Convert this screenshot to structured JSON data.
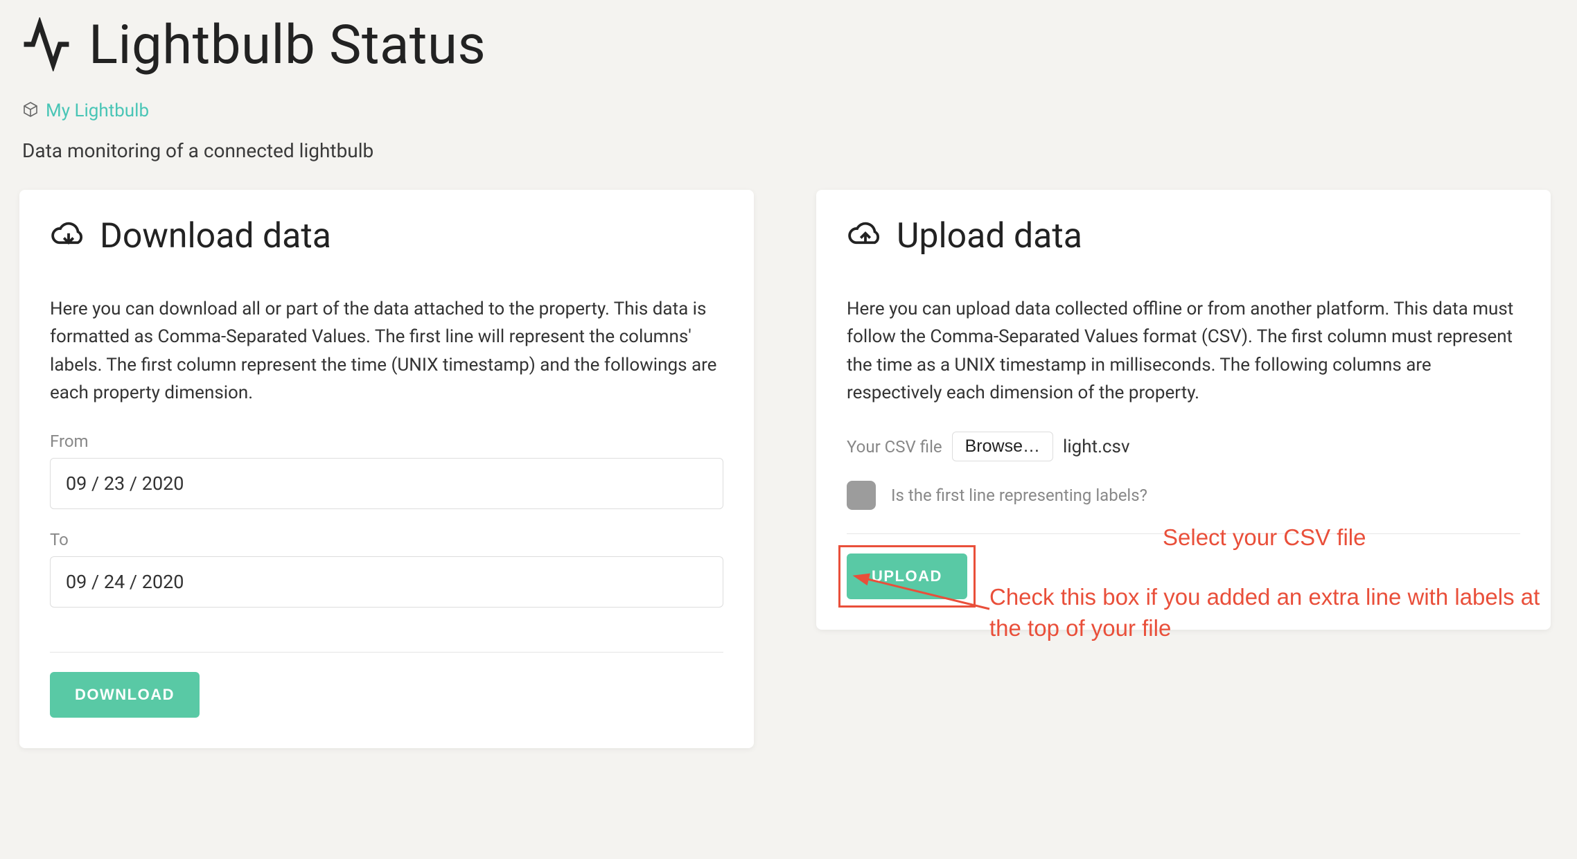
{
  "header": {
    "title": "Lightbulb Status"
  },
  "breadcrumb": {
    "label": "My Lightbulb"
  },
  "subtitle": "Data monitoring of a connected lightbulb",
  "download": {
    "title": "Download data",
    "desc": "Here you can download all or part of the data attached to the property. This data is formatted as Comma-Separated Values. The first line will represent the columns' labels. The first column represent the time (UNIX timestamp) and the followings are each property dimension.",
    "from_label": "From",
    "from_value": "09 / 23 / 2020",
    "to_label": "To",
    "to_value": "09 / 24 / 2020",
    "button": "DOWNLOAD"
  },
  "upload": {
    "title": "Upload data",
    "desc": "Here you can upload data collected offline or from another platform. This data must follow the Comma-Separated Values format (CSV). The first column must represent the time as a UNIX timestamp in milliseconds. The following columns are respectively each dimension of the property.",
    "file_label": "Your CSV file",
    "browse_label": "Browse…",
    "file_name": "light.csv",
    "checkbox_label": "Is the first line representing labels?",
    "button": "UPLOAD"
  },
  "annotations": {
    "select_file": "Select your CSV file",
    "check_box": "Check this box if you added an extra line with labels at the top of your file"
  }
}
